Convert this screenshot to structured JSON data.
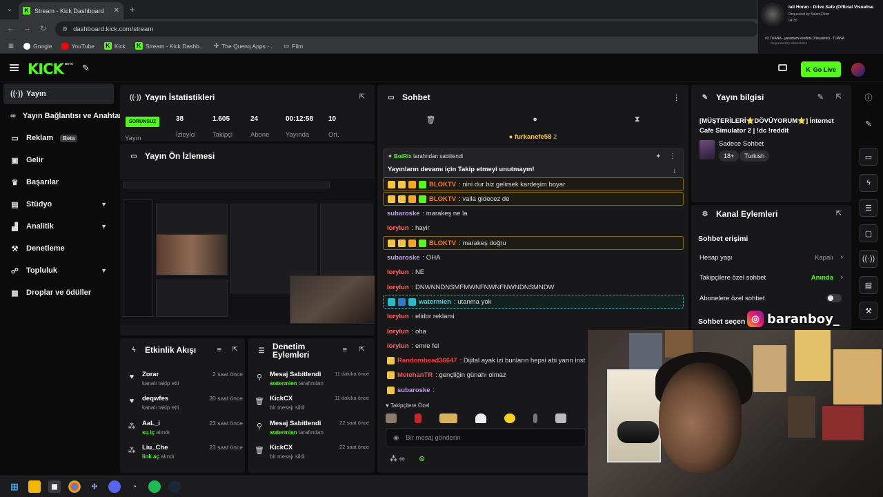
{
  "browser": {
    "tab_title": "Stream - Kick Dashboard",
    "url": "dashboard.kick.com/stream",
    "bookmarks": [
      "Google",
      "YouTube",
      "Kick",
      "Stream - Kick Dashb...",
      "The Quenq Apps -...",
      "Film"
    ]
  },
  "music": {
    "title": "iall Horan - Drive Safe (Official Visualise",
    "requested_by": "Requested by Salam23dur",
    "time": "04:30",
    "next": "#2  TUANA - yaramam kendimi (Visualizer) - TUANA",
    "next_requested_by": "Requested by Salam23dur"
  },
  "header": {
    "logo": "KICK",
    "beta": "BETA",
    "go_live": "Go Live"
  },
  "sidebar": {
    "items": [
      {
        "label": "Yayın",
        "icon": "broadcast-icon"
      },
      {
        "label": "Yayın Bağlantısı ve Anahtar",
        "icon": "link-icon"
      },
      {
        "label": "Reklam",
        "icon": "ad-icon",
        "badge": "Beta"
      },
      {
        "label": "Gelir",
        "icon": "revenue-icon"
      },
      {
        "label": "Başarılar",
        "icon": "trophy-icon"
      },
      {
        "label": "Stüdyo",
        "icon": "studio-icon"
      },
      {
        "label": "Analitik",
        "icon": "analytics-icon"
      },
      {
        "label": "Denetleme",
        "icon": "moderation-icon"
      },
      {
        "label": "Topluluk",
        "icon": "community-icon"
      },
      {
        "label": "Droplar ve ödüller",
        "icon": "drops-icon"
      }
    ]
  },
  "stats": {
    "title": "Yayın İstatistikleri",
    "status": "SORUNSUZ",
    "status_label": "Yayın",
    "items": [
      {
        "value": "38",
        "label": "İzleyici"
      },
      {
        "value": "1.605",
        "label": "Takipçi"
      },
      {
        "value": "24",
        "label": "Abone"
      },
      {
        "value": "00:12:58",
        "label": "Yayında"
      },
      {
        "value": "10",
        "label": "Ort."
      }
    ]
  },
  "preview": {
    "title": "Yayın Ön İzlemesi"
  },
  "activity": {
    "title": "Etkinlik Akışı",
    "rows": [
      {
        "name": "Zorar",
        "sub": "kanalı takip etti",
        "time": "2 saat önce"
      },
      {
        "name": "deqwfes",
        "sub": "kanalı takip etti",
        "time": "20 saat önce"
      },
      {
        "name": "AaL_i",
        "sub_bold": "su iç",
        "sub": " alındı",
        "time": "23 saat önce"
      },
      {
        "name": "Liu_Che",
        "sub_bold": "link aç",
        "sub": " alındı",
        "time": "23 saat önce"
      }
    ]
  },
  "moderation": {
    "title": "Denetim Eylemleri",
    "rows": [
      {
        "name": "Mesaj Sabitlendi",
        "sub_bold": "watermien",
        "sub": " tarafından",
        "time": "11 dakika önce"
      },
      {
        "name": "KickCX",
        "sub": "bir mesajı sildi",
        "time": "11 dakika önce"
      },
      {
        "name": "Mesaj Sabitlendi",
        "sub_bold": "watermien",
        "sub": " tarafından",
        "time": "22 saat önce"
      },
      {
        "name": "KickCX",
        "sub": "bir mesajı sildi",
        "time": "22 saat önce"
      }
    ]
  },
  "chat": {
    "title": "Sohbet",
    "top_user": "furkanefe58",
    "top_user_count": "2",
    "pinned_by": "BotRix",
    "pinned_by_suffix": "tarafından sabitlendi",
    "pinned_message": "Yayınların devamı için Takip etmeyi unutmayın!",
    "messages": [
      {
        "user": "BLOKTV",
        "color": "#ff7a1a",
        "text": ": nini dur biz gelirsek kardeşim boyar",
        "style": "highlight"
      },
      {
        "user": "BLOKTV",
        "color": "#ff7a1a",
        "text": ": valla gidecez de",
        "style": "highlight"
      },
      {
        "user": "subaroske",
        "color": "#c49bff",
        "text": ": marakeş ne la",
        "style": ""
      },
      {
        "user": "lorylun",
        "color": "#ff6b6b",
        "text": ": hayir",
        "style": ""
      },
      {
        "user": "BLOKTV",
        "color": "#ff7a1a",
        "text": ": marakeş doğru",
        "style": "highlight"
      },
      {
        "user": "subaroske",
        "color": "#c49bff",
        "text": ": OHA",
        "style": ""
      },
      {
        "user": "lorylun",
        "color": "#ff6b6b",
        "text": ": NE",
        "style": ""
      },
      {
        "user": "lorylun",
        "color": "#ff6b6b",
        "text": ": DNWNNDNSMFMWNFNWNFNWNDNSMNDW",
        "style": ""
      },
      {
        "user": "watermien",
        "color": "#3fd6f0",
        "text": ": utanma yok",
        "style": "cyan"
      },
      {
        "user": "lorylun",
        "color": "#ff6b6b",
        "text": ": elidor reklami",
        "style": ""
      },
      {
        "user": "lorylun",
        "color": "#ff6b6b",
        "text": ": oha",
        "style": ""
      },
      {
        "user": "lorylun",
        "color": "#ff6b6b",
        "text": ": emre fel",
        "style": ""
      },
      {
        "user": "Randombead36647",
        "color": "#ff3b3b",
        "text": ": Dijital ayak izi bunların hepsi abi yarın inst",
        "style": ""
      },
      {
        "user": "MetehanTR",
        "color": "#ff4d4d",
        "text": ": gençliğin günahı olmaz",
        "style": ""
      },
      {
        "user": "subaroske",
        "color": "#c49bff",
        "text": ":",
        "style": ""
      }
    ],
    "followers_only": "Takipçilere Özel",
    "input_placeholder": "Bir mesaj gönderin"
  },
  "stream_info": {
    "title": "Yayın bilgisi",
    "stream_title": "[MÜŞTERİLERİ⭐DÖVÜYORUM⭐] İnternet Cafe Simulator 2 | !dc !reddit",
    "category": "Sadece Sohbet",
    "tags": [
      "18+",
      "Turkish"
    ]
  },
  "channel_actions": {
    "title": "Kanal Eylemleri",
    "section": "Sohbet erişimi",
    "rows": [
      {
        "label": "Hesap yaşı",
        "value": "Kapalı"
      },
      {
        "label": "Takipçilere özel sohbet",
        "value": "Anında"
      },
      {
        "label": "Abonelere özel sohbet",
        "value": ""
      }
    ],
    "section2": "Sohbet seçen"
  },
  "overlay": {
    "instagram": "baranboy_"
  },
  "colors": {
    "accent": "#53fc18",
    "panel": "#18181b",
    "background": "#0b0b0c"
  }
}
